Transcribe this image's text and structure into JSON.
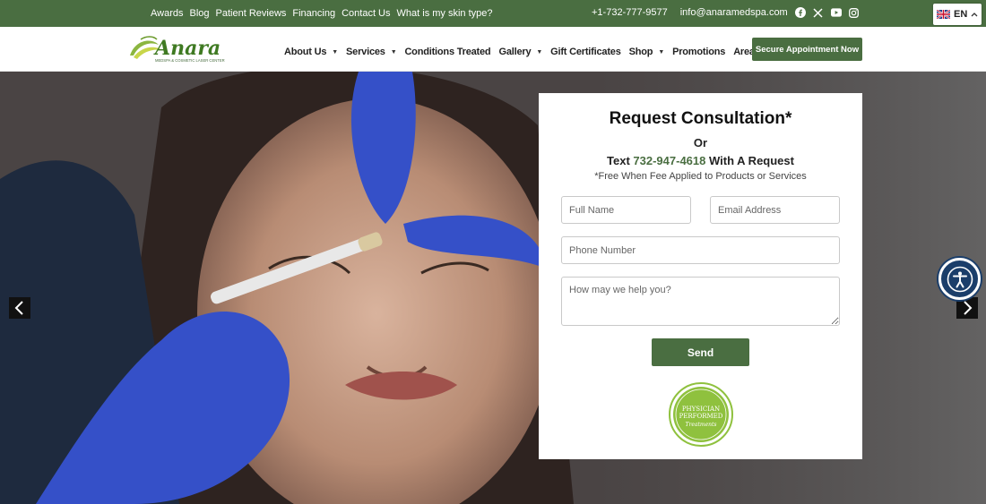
{
  "topbar": {
    "links": [
      "Awards",
      "Blog",
      "Patient Reviews",
      "Financing",
      "Contact Us",
      "What is my skin type?"
    ],
    "phone": "+1-732-777-9577",
    "email": "info@anaramedspa.com",
    "social_icons": [
      "facebook-icon",
      "x-icon",
      "youtube-icon",
      "instagram-icon"
    ],
    "language": "EN"
  },
  "nav": {
    "logo_text": "Anara",
    "logo_tagline": "MEDSPA & COSMETIC LASER CENTER",
    "items": [
      {
        "label": "About Us",
        "dropdown": true
      },
      {
        "label": "Services",
        "dropdown": true
      },
      {
        "label": "Conditions Treated",
        "dropdown": false
      },
      {
        "label": "Gallery",
        "dropdown": true
      },
      {
        "label": "Gift Certificates",
        "dropdown": false
      },
      {
        "label": "Shop",
        "dropdown": true
      },
      {
        "label": "Promotions",
        "dropdown": false
      },
      {
        "label": "Areas Served",
        "dropdown": true
      }
    ],
    "cta": "Secure Appointment Now"
  },
  "form": {
    "title": "Request Consultation*",
    "or": "Or",
    "text_prefix": "Text",
    "text_phone": "732-947-4618",
    "text_suffix": "With A Request",
    "note": "*Free When Fee Applied to Products or Services",
    "full_name_placeholder": "Full Name",
    "email_placeholder": "Email Address",
    "phone_placeholder": "Phone Number",
    "message_placeholder": "How may we help you?",
    "send_label": "Send",
    "badge_line1": "PHYSICIAN",
    "badge_line2": "PERFORMED",
    "badge_line3": "Treatments"
  },
  "colors": {
    "brand_green": "#4a6e41",
    "accessibility_blue": "#1b3e6a"
  }
}
